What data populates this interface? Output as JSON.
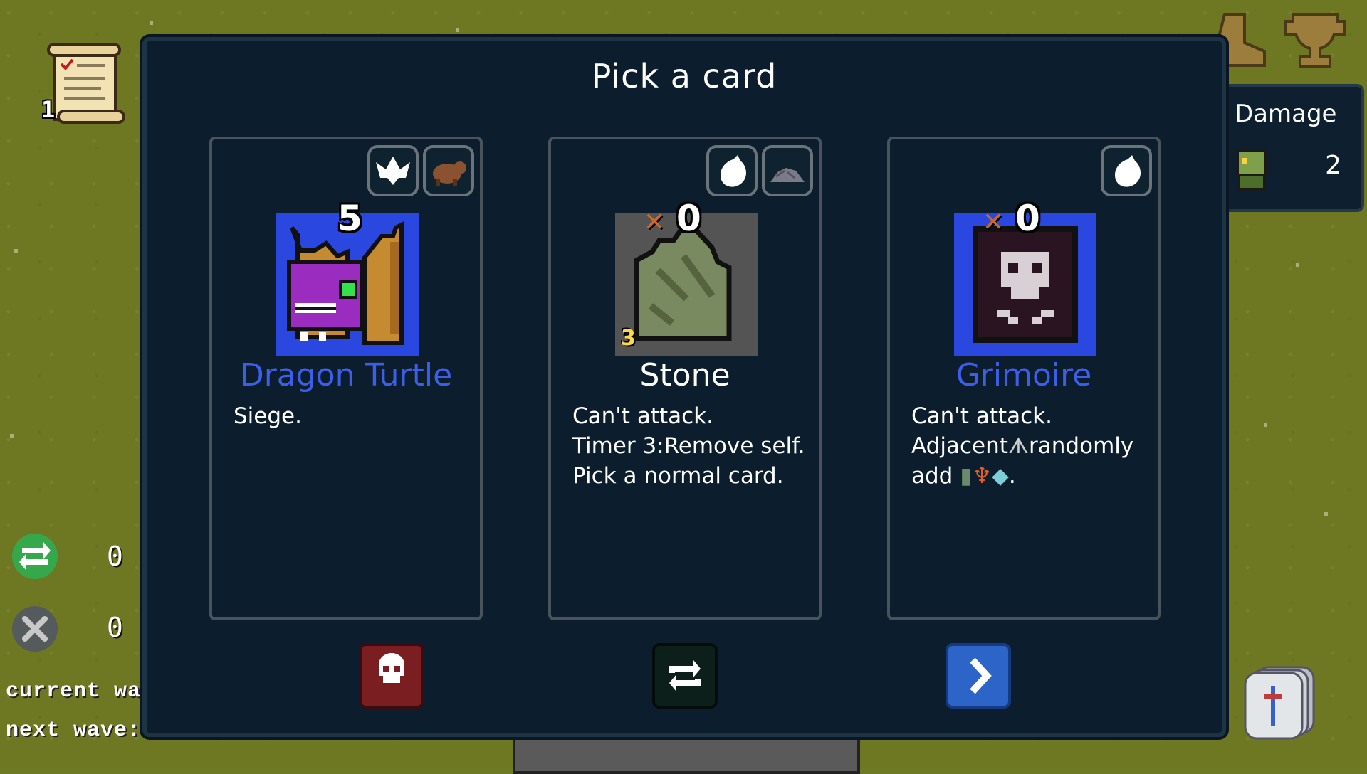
{
  "hud": {
    "quest_count": "1",
    "reroll_count": "0",
    "discard_count": "0",
    "current_wave_label": "current wave",
    "next_wave_label": "next wave:",
    "damage_label": "Damage",
    "damage_value": "2"
  },
  "modal": {
    "title": "Pick a card"
  },
  "cards": [
    {
      "name": "Dragon Turtle",
      "name_color": "#3c5ee8",
      "attack": "5",
      "tags": [
        "bird-icon",
        "beast-icon"
      ],
      "desc": [
        "Siege."
      ]
    },
    {
      "name": "Stone",
      "name_color": "#ffffff",
      "attack": "0",
      "timer": "3",
      "tags": [
        "drop-icon",
        "rock-icon"
      ],
      "desc": [
        "Can't attack.",
        "Timer 3:Remove self.",
        "Pick a normal card."
      ]
    },
    {
      "name": "Grimoire",
      "name_color": "#3c5ee8",
      "attack": "0",
      "tags": [
        "drop-icon"
      ],
      "desc": [
        "Can't attack.",
        "Adjacent",
        "randomly",
        "add",
        "."
      ]
    }
  ],
  "actions": {
    "discard_color": "#7a1e22",
    "reroll_color": "#0d1f1a",
    "next_color": "#2c64c8"
  }
}
